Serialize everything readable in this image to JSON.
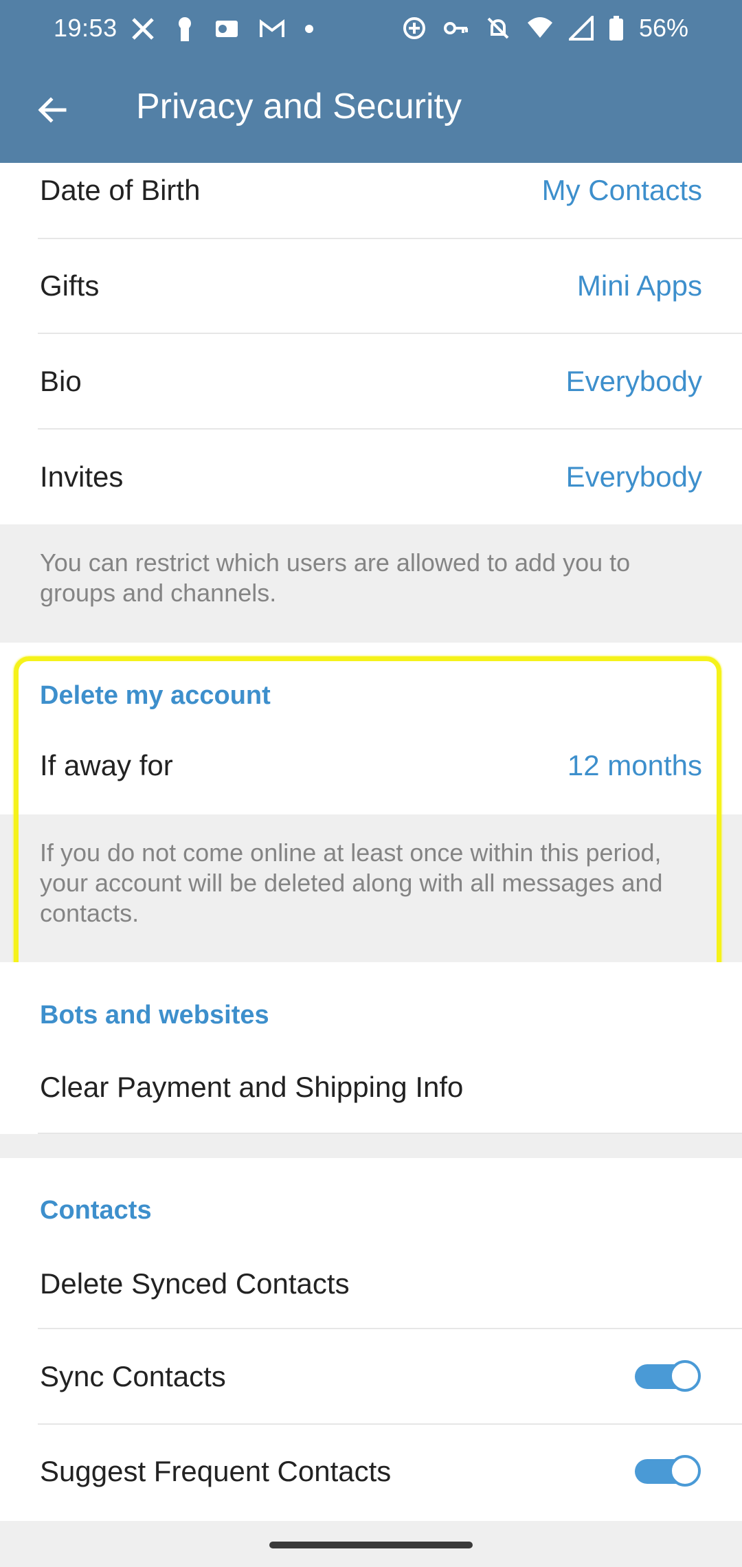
{
  "status_bar": {
    "time": "19:53",
    "battery": "56%",
    "left_icons": [
      "x-icon",
      "keyhole-icon",
      "outlook-icon",
      "gmail-icon",
      "dot-icon"
    ],
    "right_icons": [
      "data-saver-icon",
      "vpn-key-icon",
      "notifications-off-icon",
      "wifi-icon",
      "signal-icon",
      "battery-icon"
    ]
  },
  "app_bar": {
    "title": "Privacy and Security",
    "back_icon": "arrow-back-icon"
  },
  "privacy_rows": [
    {
      "label": "Date of Birth",
      "value": "My Contacts"
    },
    {
      "label": "Gifts",
      "value": "Mini Apps"
    },
    {
      "label": "Bio",
      "value": "Everybody"
    },
    {
      "label": "Invites",
      "value": "Everybody"
    }
  ],
  "invites_info": "You can restrict which users are allowed to add you to groups and channels.",
  "delete_account": {
    "header": "Delete my account",
    "row_label": "If away for",
    "row_value": "12 months",
    "info": "If you do not come online at least once within this period, your account will be deleted along with all messages and contacts."
  },
  "bots": {
    "header": "Bots and websites",
    "row_label": "Clear Payment and Shipping Info"
  },
  "contacts": {
    "header": "Contacts",
    "delete_synced": "Delete Synced Contacts",
    "sync_label": "Sync Contacts",
    "sync_on": true,
    "suggest_label": "Suggest Frequent Contacts",
    "suggest_on": true
  },
  "colors": {
    "app_bar": "#5380a6",
    "accent": "#3d8fcc",
    "highlight": "#f5f21a"
  }
}
